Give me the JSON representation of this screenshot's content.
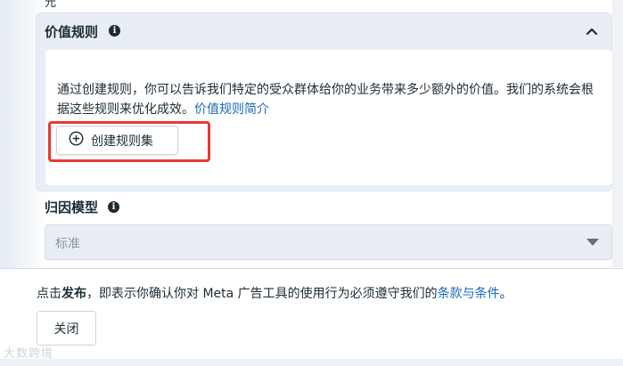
{
  "value_rules": {
    "title": "价值规则",
    "description": "通过创建规则，你可以告诉我们特定的受众群体给你的业务带来多少额外的价值。我们的系统会根据这些规则来优化成效。",
    "intro_link": "价值规则简介",
    "create_button": "创建规则集"
  },
  "attribution": {
    "title": "归因模型",
    "selected_value": "标准"
  },
  "footer": {
    "prefix": "点击",
    "bold": "发布",
    "middle": "，即表示你确认你对 Meta 广告工具的使用行为必须遵守我们的",
    "terms_link": "条款与条件",
    "suffix": "。",
    "close_button": "关闭"
  },
  "cut_top_text": "元",
  "watermark": "大数跨境",
  "colors": {
    "link": "#1a69b8",
    "highlight": "#e53935",
    "card_bg": "#e9eef6"
  },
  "icons": {
    "info": "info-icon",
    "collapse": "chevron-up-icon",
    "add": "plus-circle-icon",
    "dropdown": "caret-down-icon"
  }
}
